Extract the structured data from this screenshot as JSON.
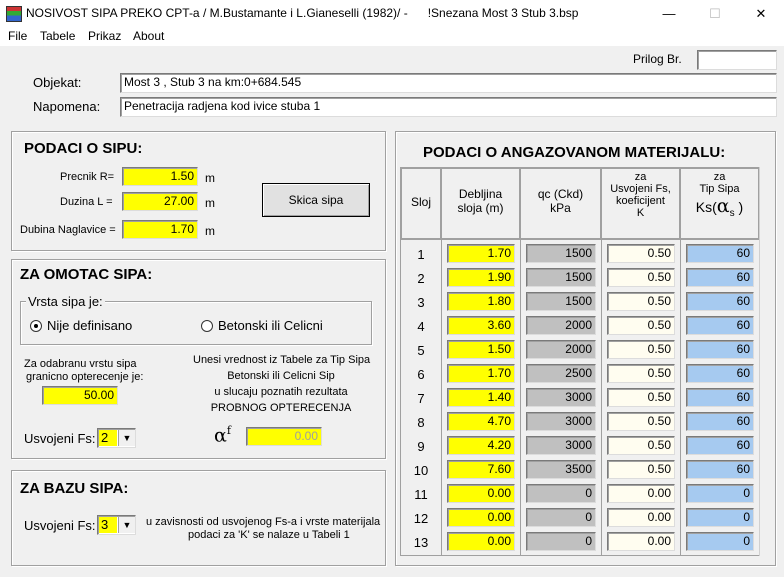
{
  "window": {
    "title": "NOSIVOST SIPA PREKO CPT-a / M.Bustamante i L.Gianeselli (1982)/ -      !Snezana Most 3 Stub 3.bsp",
    "minimize_icon": "minimize-icon",
    "maximize_icon": "maximize-icon",
    "close_icon": "close-icon",
    "minimize": "—",
    "maximize": "☐",
    "close": "✕"
  },
  "menu": [
    "File",
    "Tabele",
    "Prikaz",
    "About"
  ],
  "header": {
    "prilog_label": "Prilog Br.",
    "prilog_value": "",
    "objekat_label": "Objekat:",
    "objekat_value": "Most 3 , Stub 3 na km:0+684.545",
    "napomena_label": "Napomena:",
    "napomena_value": "Penetracija radjena kod ivice stuba 1"
  },
  "sipu": {
    "title": "PODACI O SIPU:",
    "precnik_label": "Precnik  R=",
    "precnik_value": "1.50",
    "duzina_label": "Duzina  L =",
    "duzina_value": "27.00",
    "dubina_label": "Dubina  Naglavice =",
    "dubina_value": "1.70",
    "unit": "m",
    "skica_button": "Skica sipa"
  },
  "omotac": {
    "title": "ZA OMOTAC SIPA:",
    "vrsta_label": "Vrsta sipa je:",
    "radio1": "Nije definisano",
    "radio2": "Betonski ili Celicni",
    "selected": 1,
    "granicno_line1": "Za odabranu vrstu sipa",
    "granicno_line2": "granicno opterecenje je:",
    "granicno_value": "50.00",
    "info_line1": "Unesi vrednost iz Tabele za Tip Sipa",
    "info_line2": "Betonski ili Celicni Sip",
    "info_line3": "u slucaju poznatih rezultata",
    "info_line4": "PROBNOG OPTERECENJA",
    "alpha_symbol": "α",
    "alpha_sub": "f",
    "alpha_value": "0.00",
    "fs_label": "Usvojeni Fs:",
    "fs_value": "2"
  },
  "bazu": {
    "title": "ZA BAZU SIPA:",
    "fs_label": "Usvojeni Fs:",
    "fs_value": "3",
    "note_line1": "u zavisnosti od usvojenog Fs-a i vrste materijala",
    "note_line2": "podaci za 'K' se nalaze u Tabeli 1"
  },
  "material": {
    "title": "PODACI O ANGAZOVANOM MATERIJALU:",
    "col_sloj": "Sloj",
    "col_deb1": "Debljina",
    "col_deb2": "sloja (m)",
    "col_qc1": "qc (Ckd)",
    "col_qc2": "kPa",
    "col_k1": "za",
    "col_k2": "Usvojeni Fs,",
    "col_k3": "koeficijent",
    "col_k4": "K",
    "col_ks1": "za",
    "col_ks2": "Tip Sipa",
    "col_ks3": "Ks(",
    "col_ks_alpha": "α",
    "col_ks_sub": "s",
    "col_ks_close": ")",
    "rows": [
      {
        "sloj": "1",
        "deb": "1.70",
        "qc": "1500",
        "k": "0.50",
        "ks": "60"
      },
      {
        "sloj": "2",
        "deb": "1.90",
        "qc": "1500",
        "k": "0.50",
        "ks": "60"
      },
      {
        "sloj": "3",
        "deb": "1.80",
        "qc": "1500",
        "k": "0.50",
        "ks": "60"
      },
      {
        "sloj": "4",
        "deb": "3.60",
        "qc": "2000",
        "k": "0.50",
        "ks": "60"
      },
      {
        "sloj": "5",
        "deb": "1.50",
        "qc": "2000",
        "k": "0.50",
        "ks": "60"
      },
      {
        "sloj": "6",
        "deb": "1.70",
        "qc": "2500",
        "k": "0.50",
        "ks": "60"
      },
      {
        "sloj": "7",
        "deb": "1.40",
        "qc": "3000",
        "k": "0.50",
        "ks": "60"
      },
      {
        "sloj": "8",
        "deb": "4.70",
        "qc": "3000",
        "k": "0.50",
        "ks": "60"
      },
      {
        "sloj": "9",
        "deb": "4.20",
        "qc": "3000",
        "k": "0.50",
        "ks": "60"
      },
      {
        "sloj": "10",
        "deb": "7.60",
        "qc": "3500",
        "k": "0.50",
        "ks": "60"
      },
      {
        "sloj": "11",
        "deb": "0.00",
        "qc": "0",
        "k": "0.00",
        "ks": "0"
      },
      {
        "sloj": "12",
        "deb": "0.00",
        "qc": "0",
        "k": "0.00",
        "ks": "0"
      },
      {
        "sloj": "13",
        "deb": "0.00",
        "qc": "0",
        "k": "0.00",
        "ks": "0"
      }
    ]
  },
  "colors": {
    "yellow_field": "#ffff00",
    "gray_field": "#c0c0c0",
    "blue_field": "#a6caf0",
    "window_bg": "#f0f0f0"
  }
}
